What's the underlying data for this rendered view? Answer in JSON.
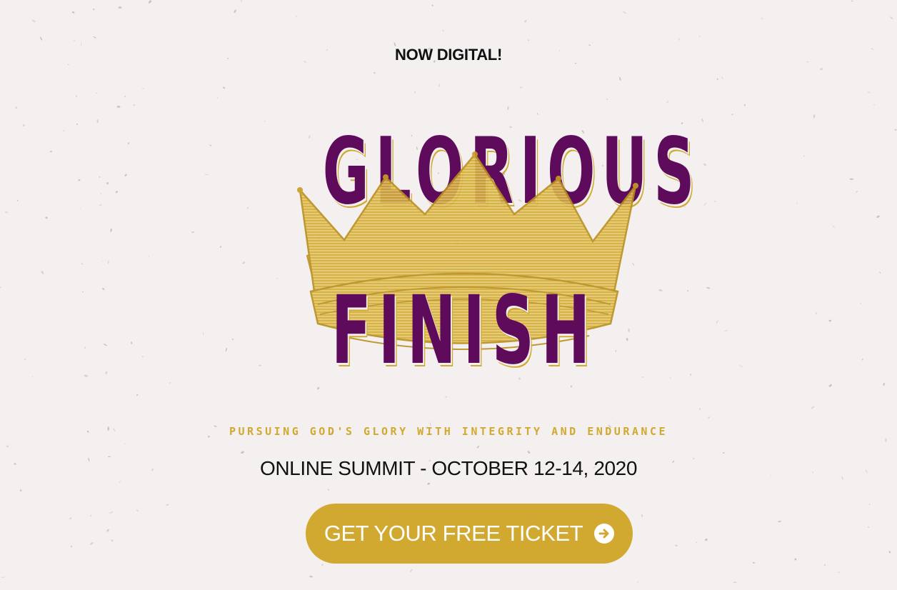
{
  "hero": {
    "eyebrow": "NOW DIGITAL!",
    "title_line1": "GLORIOUS",
    "title_line2": "FINISH",
    "tagline": "PURSUING GOD'S GLORY WITH INTEGRITY AND ENDURANCE",
    "subtitle": "ONLINE SUMMIT - OCTOBER 12-14, 2020",
    "cta_label": "GET YOUR FREE TICKET",
    "cta_icon": "arrow-right-circle-icon"
  },
  "colors": {
    "background": "#f3f0ef",
    "title_purple": "#5e0b5c",
    "gold": "#d1a930",
    "text_dark": "#111111"
  },
  "decor": {
    "logo_icon": "crown-icon"
  }
}
